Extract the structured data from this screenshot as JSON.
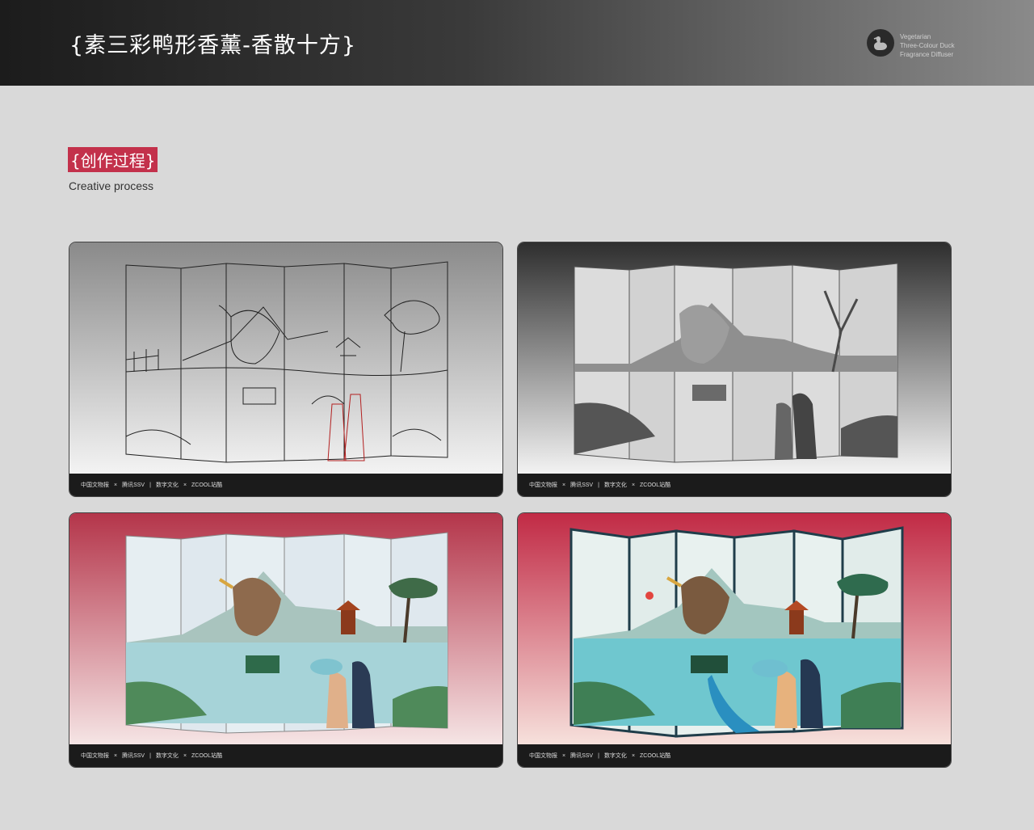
{
  "header": {
    "title": "{素三彩鸭形香薰-香散十方}",
    "brand_lines": [
      "Vegetarian",
      "Three-Colour Duck",
      "Fragrance Diffuser"
    ]
  },
  "section": {
    "title": "{创作过程}",
    "subtitle": "Creative process"
  },
  "cards": [
    {
      "stage": "sketch",
      "footer": [
        "中国文物报",
        "×",
        "腾讯SSV",
        "|",
        "数字文化",
        "×",
        "ZCOOL站酷"
      ]
    },
    {
      "stage": "grayscale",
      "footer": [
        "中国文物报",
        "×",
        "腾讯SSV",
        "|",
        "数字文化",
        "×",
        "ZCOOL站酷"
      ]
    },
    {
      "stage": "flat-color",
      "footer": [
        "中国文物报",
        "×",
        "腾讯SSV",
        "|",
        "数字文化",
        "×",
        "ZCOOL站酷"
      ]
    },
    {
      "stage": "final",
      "footer": [
        "中国文物报",
        "×",
        "腾讯SSV",
        "|",
        "数字文化",
        "×",
        "ZCOOL站酷"
      ]
    }
  ],
  "colors": {
    "accent": "#c3314b",
    "header_dark": "#1c1c1c",
    "page_bg": "#d9d9d9"
  }
}
